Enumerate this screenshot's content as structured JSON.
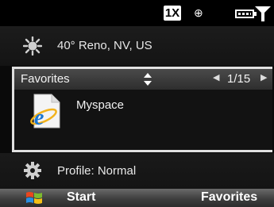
{
  "status": {
    "network_badge": "1X",
    "gps_glyph": "⊕",
    "battery_icon": "battery-icon",
    "signal_icon": "signal-strength-icon"
  },
  "weather": {
    "icon": "sun-icon",
    "text": "40° Reno, NV, US"
  },
  "favorites": {
    "title": "Favorites",
    "prev_glyph": "◀",
    "next_glyph": "▶",
    "page": "1/15",
    "item": {
      "icon": "internet-explorer-icon",
      "label": "Myspace"
    }
  },
  "profile": {
    "icon": "gear-icon",
    "text": "Profile: Normal"
  },
  "softkeys": {
    "left": "Start",
    "right": "Favorites"
  },
  "colors": {
    "panel_border": "#e0e0e0",
    "background": "#0a0a0a"
  }
}
